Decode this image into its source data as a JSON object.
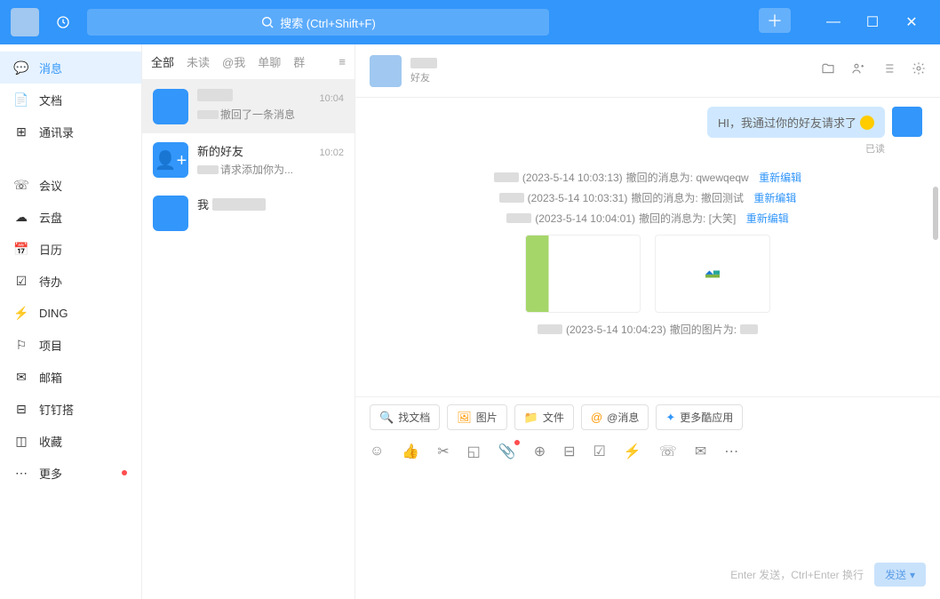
{
  "search": {
    "placeholder": "搜索 (Ctrl+Shift+F)"
  },
  "sidebar": {
    "items": [
      {
        "icon": "chat",
        "label": "消息",
        "active": true
      },
      {
        "icon": "doc",
        "label": "文档"
      },
      {
        "icon": "contacts",
        "label": "通讯录"
      },
      {
        "icon": "meeting",
        "label": "会议"
      },
      {
        "icon": "cloud",
        "label": "云盘"
      },
      {
        "icon": "calendar",
        "label": "日历"
      },
      {
        "icon": "todo",
        "label": "待办"
      },
      {
        "icon": "ding",
        "label": "DING"
      },
      {
        "icon": "project",
        "label": "项目"
      },
      {
        "icon": "mail",
        "label": "邮箱"
      },
      {
        "icon": "dingding",
        "label": "钉钉搭"
      },
      {
        "icon": "favorite",
        "label": "收藏"
      },
      {
        "icon": "more",
        "label": "更多",
        "dot": true
      }
    ]
  },
  "conv_tabs": [
    "全部",
    "未读",
    "@我",
    "单聊",
    "群"
  ],
  "conversations": [
    {
      "name": "",
      "time": "10:04",
      "preview_prefix": "",
      "preview": "撤回了一条消息",
      "selected": true
    },
    {
      "name": "新的好友",
      "time": "10:02",
      "preview_prefix": "",
      "preview": "请求添加你为..."
    },
    {
      "name": "我",
      "time": "",
      "preview": ""
    }
  ],
  "chat_header": {
    "sub": "好友"
  },
  "bubble": "HI，我通过你的好友请求了",
  "read_status": "已读",
  "recalls": [
    {
      "ts": "(2023-5-14 10:03:13)",
      "txt": "撤回的消息为: qwewqeqw",
      "edit": "重新编辑"
    },
    {
      "ts": "(2023-5-14 10:03:31)",
      "txt": "撤回的消息为: 撤回测试",
      "edit": "重新编辑"
    },
    {
      "ts": "(2023-5-14 10:04:01)",
      "txt": "撤回的消息为: [大笑]",
      "edit": "重新编辑"
    }
  ],
  "recall_img_line": {
    "ts": "(2023-5-14 10:04:23)",
    "txt": "撤回的图片为:"
  },
  "quick_actions": [
    {
      "label": "找文档",
      "color": "#3296fa"
    },
    {
      "label": "图片",
      "color": "#ff9800"
    },
    {
      "label": "文件",
      "color": "#3296fa"
    },
    {
      "label": "@消息",
      "color": "#ff9800"
    },
    {
      "label": "更多酷应用",
      "color": "#3296fa"
    }
  ],
  "send_hint": "Enter 发送，Ctrl+Enter 换行",
  "send_label": "发送"
}
